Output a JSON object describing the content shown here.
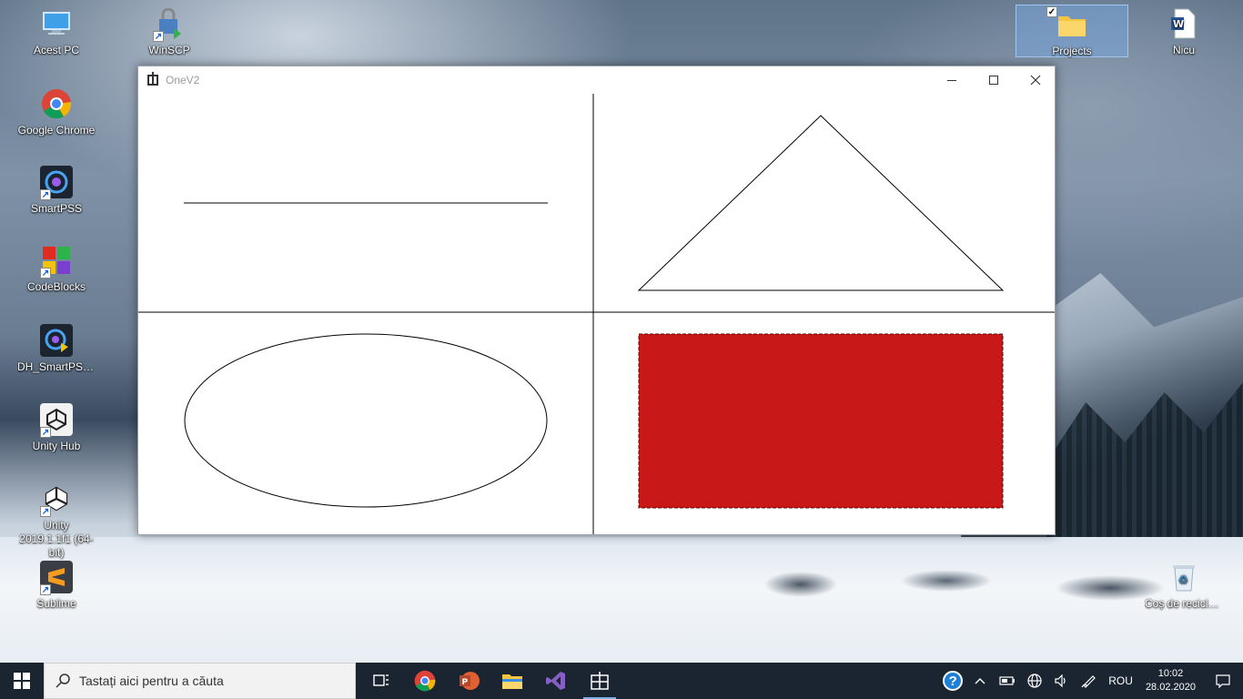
{
  "desktop": {
    "icons": [
      {
        "label": "Acest PC"
      },
      {
        "label": "WinSCP"
      },
      {
        "label": "Google Chrome"
      },
      {
        "label": "SmartPSS"
      },
      {
        "label": "CodeBlocks"
      },
      {
        "label": "DH_SmartPSS_Intern..."
      },
      {
        "label": "Unity Hub"
      },
      {
        "label": "Unity 2019.1.1f1 (64-bit)"
      },
      {
        "label": "Sublime"
      },
      {
        "label": "Projects"
      },
      {
        "label": "Nicu"
      },
      {
        "label": "Coș de reciclare"
      }
    ]
  },
  "window": {
    "title": "OneV2",
    "shapes": [
      {
        "kind": "line",
        "quadrant": "top-left",
        "stroke": "#000000"
      },
      {
        "kind": "triangle",
        "quadrant": "top-right",
        "stroke": "#000000",
        "fill": "none"
      },
      {
        "kind": "ellipse",
        "quadrant": "bottom-left",
        "stroke": "#000000",
        "fill": "none"
      },
      {
        "kind": "rectangle",
        "quadrant": "bottom-right",
        "fill": "#c81818",
        "stroke": "dashed"
      }
    ]
  },
  "taskbar": {
    "search_placeholder": "Tastați aici pentru a căuta",
    "apps": [
      "task-view",
      "google-chrome",
      "powerpoint",
      "file-explorer",
      "visual-studio",
      "onev2"
    ],
    "tray": {
      "help": "?",
      "language": "ROU",
      "time": "10:02",
      "date": "28.02.2020"
    }
  },
  "colors": {
    "taskbar_bg": "#1b2531",
    "rect_fill": "#c81818",
    "selected_icon": "#78aae6"
  }
}
